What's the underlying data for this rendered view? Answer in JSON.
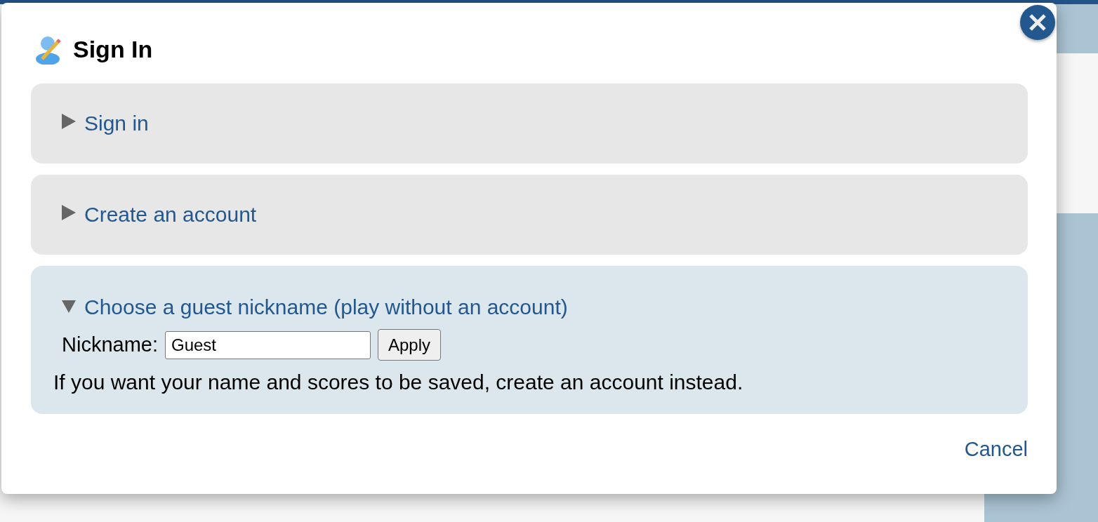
{
  "dialog": {
    "title": "Sign In",
    "sections": [
      {
        "title": "Sign in",
        "expanded": false
      },
      {
        "title": "Create an account",
        "expanded": false
      },
      {
        "title": "Choose a guest nickname (play without an account)",
        "expanded": true,
        "field_label": "Nickname:",
        "field_value": "Guest",
        "button": "Apply",
        "note": "If you want your name and scores to be saved, create an account instead."
      }
    ],
    "cancel": "Cancel"
  }
}
